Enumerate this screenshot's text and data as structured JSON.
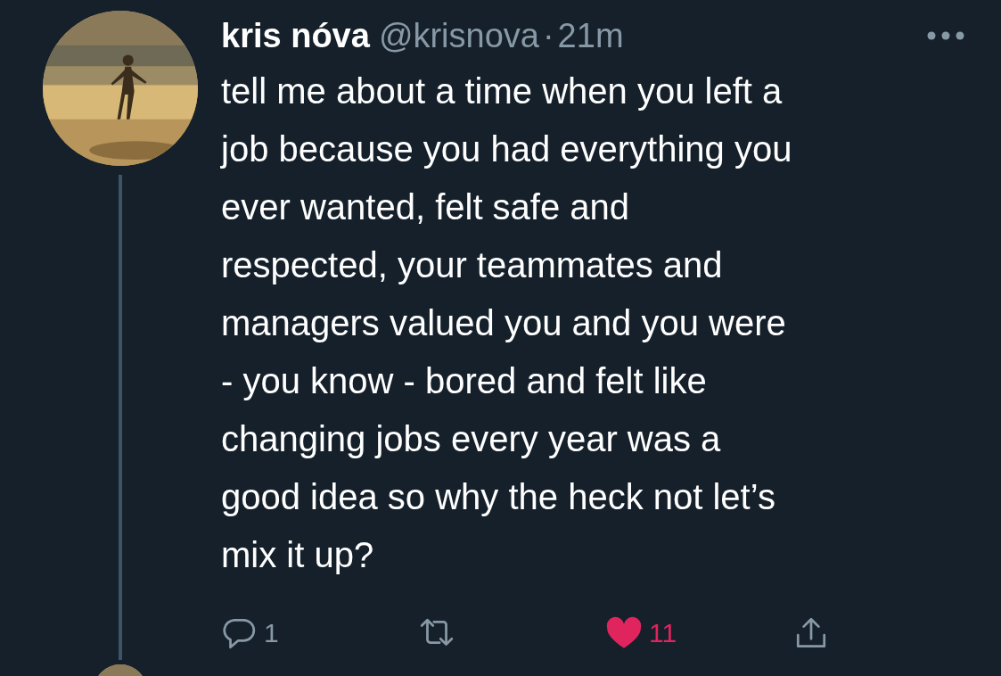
{
  "tweet": {
    "author": {
      "name": "kris nóva",
      "handle": "@krisnova",
      "separator": "·",
      "time": "21m"
    },
    "text": "tell me about a time when you left a\njob because you had everything you\never wanted, felt safe and\nrespected, your teammates and\nmanagers valued you and you were\n- you know - bored and felt like\nchanging jobs every year was a\ngood idea so why the heck not let’s\nmix it up?",
    "actions": [
      {
        "kind": "reply",
        "count": "1"
      },
      {
        "kind": "retweet"
      },
      {
        "kind": "like",
        "count": "11",
        "liked": true
      },
      {
        "kind": "share"
      }
    ]
  }
}
